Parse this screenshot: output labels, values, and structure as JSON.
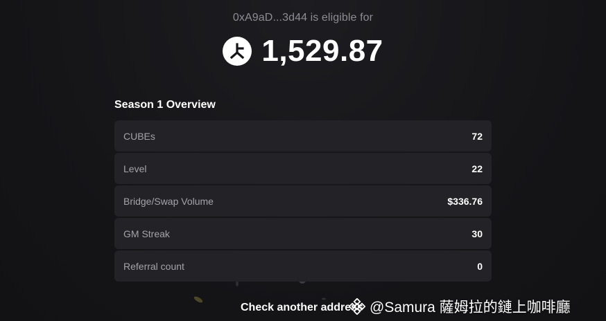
{
  "header": {
    "eligible_text": "0xA9aD...3d44 is eligible for",
    "amount": "1,529.87",
    "token_icon": "token-logo-icon"
  },
  "overview": {
    "title": "Season 1 Overview",
    "rows": [
      {
        "label": "CUBEs",
        "value": "72"
      },
      {
        "label": "Level",
        "value": "22"
      },
      {
        "label": "Bridge/Swap Volume",
        "value": "$336.76"
      },
      {
        "label": "GM Streak",
        "value": "30"
      },
      {
        "label": "Referral count",
        "value": "0"
      }
    ]
  },
  "footer": {
    "check_another_label": "Check another address"
  },
  "watermark": {
    "text": "@Samura 薩姆拉的鏈上咖啡廳",
    "icon": "binance-logo-icon"
  },
  "colors": {
    "background": "#151518",
    "row_background": "#232327",
    "muted_text": "#8c8c93",
    "label_text": "#a3a3aa"
  }
}
